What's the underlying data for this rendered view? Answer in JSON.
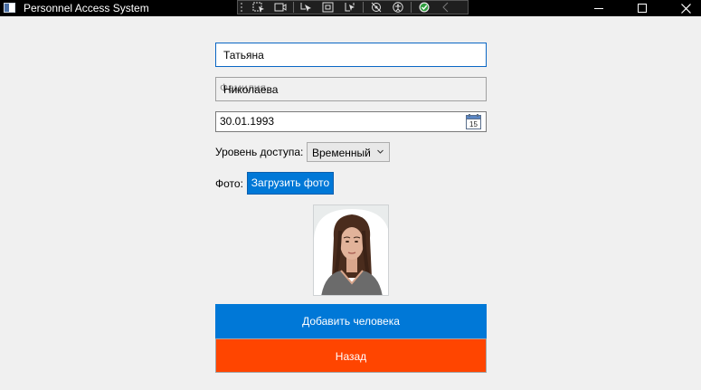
{
  "window": {
    "title": "Personnel Access System"
  },
  "toolbar": {
    "items": [
      "select-element-icon",
      "live-preview-icon",
      "pointer-icon",
      "layout-adorner-icon",
      "hot-reload-icon",
      "track-focus-icon",
      "accessibility-icon",
      "binding-ok-icon",
      "collapse-chevron-icon"
    ]
  },
  "form": {
    "first_name": "Татьяна",
    "last_name": "Николаева",
    "last_name_ghost": "Фамилия",
    "birth_date": "30.01.1993",
    "calendar_day": "15",
    "access_label": "Уровень доступа:",
    "access_value": "Временный",
    "photo_label": "Фото:",
    "upload_button": "Загрузить фото"
  },
  "actions": {
    "add_button": "Добавить человека",
    "back_button": "Назад"
  },
  "colors": {
    "primary": "#0078d7",
    "danger": "#ff4500",
    "focus_border": "#0a67c4"
  }
}
